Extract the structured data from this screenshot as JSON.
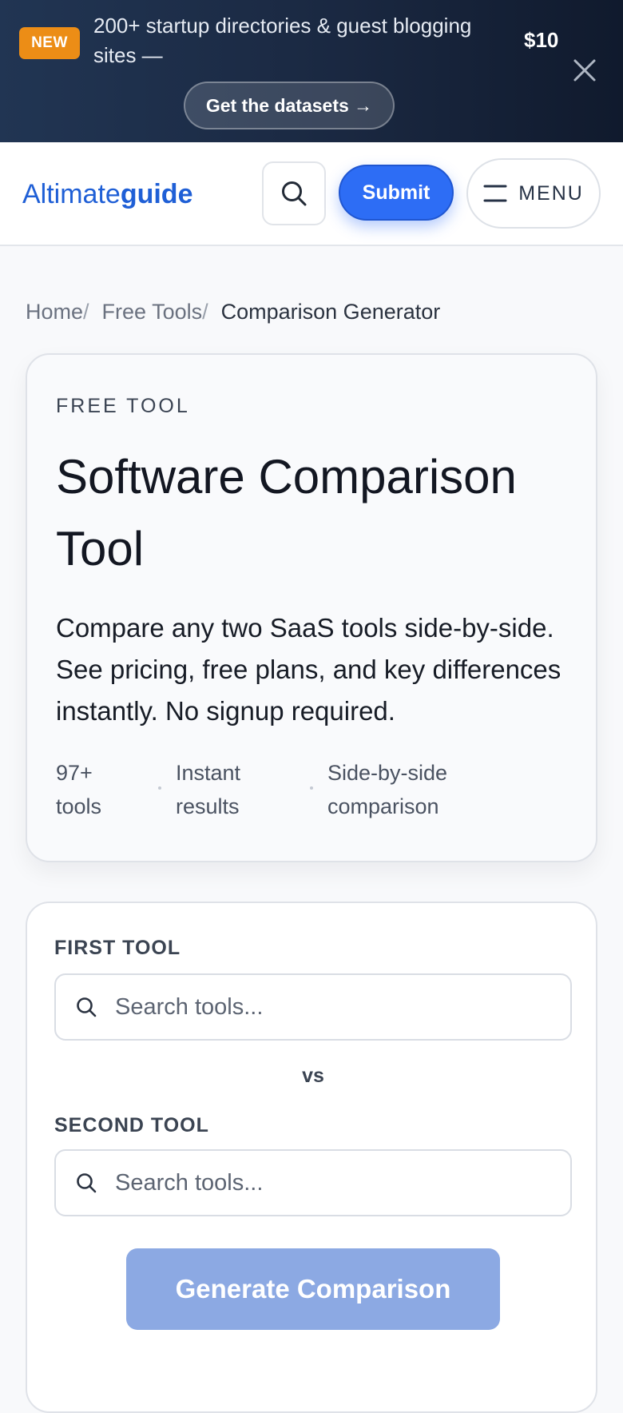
{
  "promo": {
    "badge": "NEW",
    "message": "200+ startup directories & guest blogging sites —",
    "price": "$10",
    "cta_label": "Get the datasets →",
    "colors": {
      "badge": "#ec8d16",
      "background": "#1a2841"
    }
  },
  "header": {
    "logo_light": "Altimate",
    "logo_bold": "guide",
    "submit_label": "Submit",
    "menu_label": "MENU",
    "colors": {
      "brand": "#1f5fd6",
      "primary_button": "#2d6df5"
    }
  },
  "breadcrumb": {
    "items": [
      "Home",
      "Free Tools"
    ],
    "separator": "/",
    "current": "Comparison Generator"
  },
  "hero": {
    "eyebrow": "FREE TOOL",
    "title": "Software Comparison Tool",
    "description": "Compare any two SaaS tools side-by-side. See pricing, free plans, and key differences instantly. No signup required.",
    "stats": [
      "97+ tools",
      "Instant results",
      "Side-by-side comparison"
    ]
  },
  "form": {
    "first_label": "FIRST TOOL",
    "first_placeholder": "Search tools...",
    "first_value": "",
    "vs_label": "vs",
    "second_label": "SECOND TOOL",
    "second_placeholder": "Search tools...",
    "second_value": "",
    "generate_label": "Generate Comparison",
    "generate_state": "disabled",
    "colors": {
      "generate_disabled": "#8ca9e3"
    }
  },
  "icons": {
    "close": "close-icon",
    "search": "search-icon",
    "menu": "menu-icon"
  }
}
